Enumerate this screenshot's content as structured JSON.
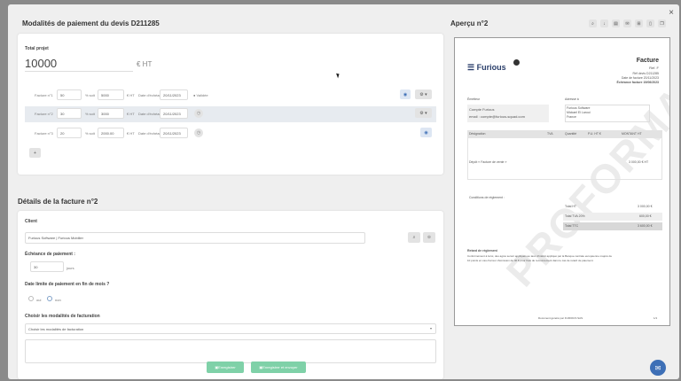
{
  "modal": {
    "close": "×",
    "payment_title": "Modalités de paiement du devis D211285",
    "preview_title": "Aperçu n°2",
    "invoice_title": "Détails de la facture n°2"
  },
  "payment": {
    "total_label": "Total projet",
    "total_value": "10000",
    "total_unit": "€ HT",
    "rows": [
      {
        "label": "Facture n°1",
        "percent": "50",
        "percent_unit": "% soit",
        "amount": "5000",
        "amount_unit": "€ HT",
        "due_label": "Date d'échéance",
        "date": "20/11/2023",
        "status": "Validée"
      },
      {
        "label": "Facture n°2",
        "percent": "30",
        "percent_unit": "% soit",
        "amount": "3000",
        "amount_unit": "€ HT",
        "due_label": "Date d'échéance",
        "date": "20/11/2023",
        "status": ""
      },
      {
        "label": "Facture n°3",
        "percent": "20",
        "percent_unit": "% soit",
        "amount": "2000.00",
        "amount_unit": "€ HT",
        "due_label": "Date d'échéance",
        "date": "20/11/2023",
        "status": ""
      }
    ],
    "add_button": "+"
  },
  "invoice": {
    "client_label": "Client",
    "client_value": "Furious Software | Furious Mobilier",
    "due_label": "Échéance de paiement :",
    "due_value": "30",
    "due_unit": "jours",
    "end_month_label": "Date limite de paiement en fin de mois ?",
    "opt_yes": "oui",
    "opt_no": "non",
    "modalities_label": "Choisir les modalités de facturation",
    "modalities_placeholder": "Choisir les modalités de facturation",
    "save_label": "Enregistrer",
    "save_send_label": "Enregistrer et envoyer"
  },
  "preview": {
    "brand": "Furious",
    "doc_title": "Facture",
    "doc_number": "Ref. F",
    "ref_line": "Réf devis D211285",
    "date_line": "Date de facture 20/11/2023",
    "due_line": "Échéance facture 19/06/2023",
    "emitter_label": "Émetteur",
    "emitter_name": "Compte Furious",
    "emitter_email": "email : compte@furious-squad.com",
    "recipient_label": "Adressé à",
    "recipient_name": "Furious Software",
    "recipient_addr": "Mickael El Laroui",
    "recipient_country": "France",
    "col_designation": "Désignation",
    "col_tva": "TVA",
    "col_qty": "Quantité",
    "col_pu": "P.U. HT €",
    "col_amount": "MONTANT HT",
    "line_item": "Dépôt « Facture de vente »",
    "line_amount": "3 000,00 € HT",
    "conditions": "Conditions de règlement :",
    "total_ht_label": "Total HT",
    "total_ht_value": "3 000,00 €",
    "total_tva_label": "Total TVA 20%",
    "total_tva_value": "600,00 €",
    "total_ttc_label": "Total TTC",
    "total_ttc_value": "3 600,00 €",
    "late_title": "Retard de règlement",
    "late_text_1": "Conformément à la loi, des agios seront appliqués au taux d'intérêt appliqué par la Banque centrale européenne majoré de",
    "late_text_2": "10 points en cas d'erreur d'émission de 40 € pour frais de recouvrement dans le cas de retard de paiement.",
    "footer": "Document généré par FURIOUS SAS",
    "page": "1/1",
    "watermark": "PROFORMA"
  },
  "toolbar": {
    "icons": [
      "zoom-icon",
      "download-icon",
      "print-icon",
      "email-icon",
      "cart-icon",
      "file-icon",
      "copy-icon"
    ]
  },
  "colors": {
    "accent_green": "#7fd1a8",
    "accent_blue": "#3d6fb6",
    "highlight_row": "#e7ebf0"
  }
}
